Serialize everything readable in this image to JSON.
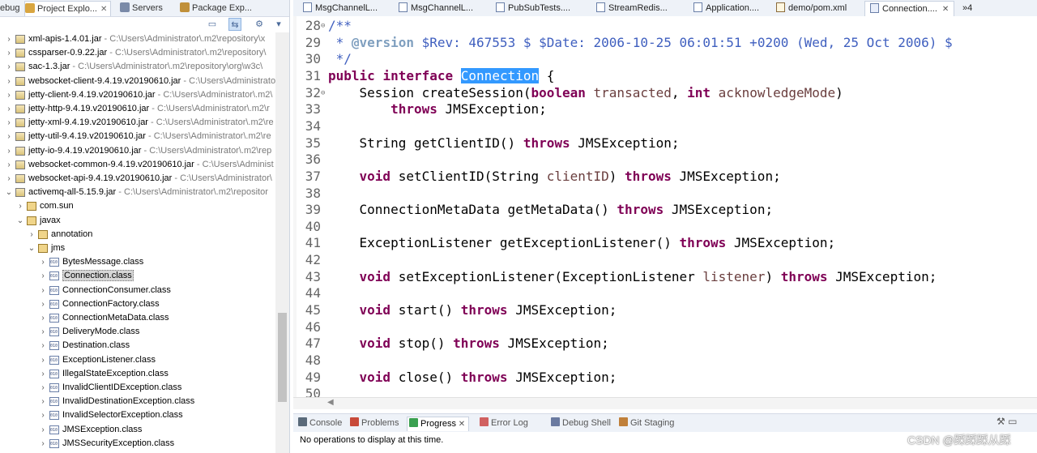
{
  "left_panel": {
    "tabs": [
      {
        "label": "ebug",
        "icon": "debug-icon",
        "active": false,
        "closable": false
      },
      {
        "label": "Project Explo...",
        "icon": "project-explorer-icon",
        "active": true,
        "closable": true
      },
      {
        "label": "Servers",
        "icon": "servers-icon",
        "active": false,
        "closable": false
      },
      {
        "label": "Package Exp...",
        "icon": "package-explorer-icon",
        "active": false,
        "closable": false
      }
    ],
    "tree": [
      {
        "type": "jar",
        "name": "xml-apis-1.4.01.jar",
        "path": " - C:\\Users\\Administrator\\.m2\\repository\\x",
        "indent": 0,
        "arrow": "collapsed"
      },
      {
        "type": "jar",
        "name": "cssparser-0.9.22.jar",
        "path": " - C:\\Users\\Administrator\\.m2\\repository\\",
        "indent": 0,
        "arrow": "collapsed"
      },
      {
        "type": "jar",
        "name": "sac-1.3.jar",
        "path": " - C:\\Users\\Administrator\\.m2\\repository\\org\\w3c\\",
        "indent": 0,
        "arrow": "collapsed"
      },
      {
        "type": "jar",
        "name": "websocket-client-9.4.19.v20190610.jar",
        "path": " - C:\\Users\\Administrato",
        "indent": 0,
        "arrow": "collapsed"
      },
      {
        "type": "jar",
        "name": "jetty-client-9.4.19.v20190610.jar",
        "path": " - C:\\Users\\Administrator\\.m2\\",
        "indent": 0,
        "arrow": "collapsed"
      },
      {
        "type": "jar",
        "name": "jetty-http-9.4.19.v20190610.jar",
        "path": " - C:\\Users\\Administrator\\.m2\\r",
        "indent": 0,
        "arrow": "collapsed"
      },
      {
        "type": "jar",
        "name": "jetty-xml-9.4.19.v20190610.jar",
        "path": " - C:\\Users\\Administrator\\.m2\\re",
        "indent": 0,
        "arrow": "collapsed"
      },
      {
        "type": "jar",
        "name": "jetty-util-9.4.19.v20190610.jar",
        "path": " - C:\\Users\\Administrator\\.m2\\re",
        "indent": 0,
        "arrow": "collapsed"
      },
      {
        "type": "jar",
        "name": "jetty-io-9.4.19.v20190610.jar",
        "path": " - C:\\Users\\Administrator\\.m2\\rep",
        "indent": 0,
        "arrow": "collapsed"
      },
      {
        "type": "jar",
        "name": "websocket-common-9.4.19.v20190610.jar",
        "path": " - C:\\Users\\Administ",
        "indent": 0,
        "arrow": "collapsed"
      },
      {
        "type": "jar",
        "name": "websocket-api-9.4.19.v20190610.jar",
        "path": " - C:\\Users\\Administrator\\",
        "indent": 0,
        "arrow": "collapsed"
      },
      {
        "type": "jar",
        "name": "activemq-all-5.15.9.jar",
        "path": " - C:\\Users\\Administrator\\.m2\\repositor",
        "indent": 0,
        "arrow": "expanded"
      },
      {
        "type": "pkg",
        "name": "com.sun",
        "path": "",
        "indent": 1,
        "arrow": "collapsed"
      },
      {
        "type": "pkg",
        "name": "javax",
        "path": "",
        "indent": 1,
        "arrow": "expanded"
      },
      {
        "type": "pkg",
        "name": "annotation",
        "path": "",
        "indent": 2,
        "arrow": "collapsed"
      },
      {
        "type": "pkg",
        "name": "jms",
        "path": "",
        "indent": 2,
        "arrow": "expanded"
      },
      {
        "type": "cls",
        "name": "BytesMessage.class",
        "path": "",
        "indent": 3,
        "arrow": "collapsed"
      },
      {
        "type": "cls",
        "name": "Connection.class",
        "path": "",
        "indent": 3,
        "arrow": "collapsed",
        "selected": true
      },
      {
        "type": "cls",
        "name": "ConnectionConsumer.class",
        "path": "",
        "indent": 3,
        "arrow": "collapsed"
      },
      {
        "type": "cls",
        "name": "ConnectionFactory.class",
        "path": "",
        "indent": 3,
        "arrow": "collapsed"
      },
      {
        "type": "cls",
        "name": "ConnectionMetaData.class",
        "path": "",
        "indent": 3,
        "arrow": "collapsed"
      },
      {
        "type": "cls",
        "name": "DeliveryMode.class",
        "path": "",
        "indent": 3,
        "arrow": "collapsed"
      },
      {
        "type": "cls",
        "name": "Destination.class",
        "path": "",
        "indent": 3,
        "arrow": "collapsed"
      },
      {
        "type": "cls",
        "name": "ExceptionListener.class",
        "path": "",
        "indent": 3,
        "arrow": "collapsed"
      },
      {
        "type": "cls",
        "name": "IllegalStateException.class",
        "path": "",
        "indent": 3,
        "arrow": "collapsed"
      },
      {
        "type": "cls",
        "name": "InvalidClientIDException.class",
        "path": "",
        "indent": 3,
        "arrow": "collapsed"
      },
      {
        "type": "cls",
        "name": "InvalidDestinationException.class",
        "path": "",
        "indent": 3,
        "arrow": "collapsed"
      },
      {
        "type": "cls",
        "name": "InvalidSelectorException.class",
        "path": "",
        "indent": 3,
        "arrow": "collapsed"
      },
      {
        "type": "cls",
        "name": "JMSException.class",
        "path": "",
        "indent": 3,
        "arrow": "collapsed"
      },
      {
        "type": "cls",
        "name": "JMSSecurityException.class",
        "path": "",
        "indent": 3,
        "arrow": "collapsed"
      }
    ]
  },
  "editor": {
    "tabs": [
      {
        "label": "MsgChannelL...",
        "icon": "java-file-icon",
        "active": false
      },
      {
        "label": "MsgChannelL...",
        "icon": "java-file-icon",
        "active": false
      },
      {
        "label": "PubSubTests....",
        "icon": "java-file-icon",
        "active": false
      },
      {
        "label": "StreamRedis...",
        "icon": "java-file-icon",
        "active": false
      },
      {
        "label": "Application....",
        "icon": "java-file-icon",
        "active": false
      },
      {
        "label": "demo/pom.xml",
        "icon": "xml-file-icon",
        "active": false
      },
      {
        "label": "Connection....",
        "icon": "class-file-icon",
        "active": true
      }
    ],
    "overflow_label": "»4",
    "lines": [
      {
        "n": "28",
        "fold": "⊖",
        "segs": [
          {
            "t": "/**",
            "c": "cm"
          }
        ]
      },
      {
        "n": "29",
        "fold": "",
        "segs": [
          {
            "t": " * ",
            "c": "cm"
          },
          {
            "t": "@version",
            "c": "cm-tag"
          },
          {
            "t": " $Rev: 467553 $ $Date: 2006-10-25 06:01:51 +0200 (Wed, 25 Oct 2006) $",
            "c": "cm"
          }
        ]
      },
      {
        "n": "30",
        "fold": "",
        "segs": [
          {
            "t": " */",
            "c": "cm"
          }
        ]
      },
      {
        "n": "31",
        "fold": "",
        "segs": [
          {
            "t": "public",
            "c": "kw"
          },
          {
            "t": " ",
            "c": ""
          },
          {
            "t": "interface",
            "c": "kw"
          },
          {
            "t": " ",
            "c": ""
          },
          {
            "t": "Connection",
            "c": "hl"
          },
          {
            "t": " {",
            "c": ""
          }
        ]
      },
      {
        "n": "32",
        "fold": "⊖",
        "segs": [
          {
            "t": "    Session createSession(",
            "c": ""
          },
          {
            "t": "boolean",
            "c": "kw"
          },
          {
            "t": " ",
            "c": ""
          },
          {
            "t": "transacted",
            "c": "param"
          },
          {
            "t": ", ",
            "c": ""
          },
          {
            "t": "int",
            "c": "kw"
          },
          {
            "t": " ",
            "c": ""
          },
          {
            "t": "acknowledgeMode",
            "c": "param"
          },
          {
            "t": ")",
            "c": ""
          }
        ]
      },
      {
        "n": "33",
        "fold": "",
        "segs": [
          {
            "t": "        ",
            "c": ""
          },
          {
            "t": "throws",
            "c": "kw"
          },
          {
            "t": " JMSException;",
            "c": ""
          }
        ]
      },
      {
        "n": "34",
        "fold": "",
        "segs": []
      },
      {
        "n": "35",
        "fold": "",
        "segs": [
          {
            "t": "    String getClientID() ",
            "c": ""
          },
          {
            "t": "throws",
            "c": "kw"
          },
          {
            "t": " JMSException;",
            "c": ""
          }
        ]
      },
      {
        "n": "36",
        "fold": "",
        "segs": []
      },
      {
        "n": "37",
        "fold": "",
        "segs": [
          {
            "t": "    ",
            "c": ""
          },
          {
            "t": "void",
            "c": "kw"
          },
          {
            "t": " setClientID(String ",
            "c": ""
          },
          {
            "t": "clientID",
            "c": "param"
          },
          {
            "t": ") ",
            "c": ""
          },
          {
            "t": "throws",
            "c": "kw"
          },
          {
            "t": " JMSException;",
            "c": ""
          }
        ]
      },
      {
        "n": "38",
        "fold": "",
        "segs": []
      },
      {
        "n": "39",
        "fold": "",
        "segs": [
          {
            "t": "    ConnectionMetaData getMetaData() ",
            "c": ""
          },
          {
            "t": "throws",
            "c": "kw"
          },
          {
            "t": " JMSException;",
            "c": ""
          }
        ]
      },
      {
        "n": "40",
        "fold": "",
        "segs": []
      },
      {
        "n": "41",
        "fold": "",
        "segs": [
          {
            "t": "    ExceptionListener getExceptionListener() ",
            "c": ""
          },
          {
            "t": "throws",
            "c": "kw"
          },
          {
            "t": " JMSException;",
            "c": ""
          }
        ]
      },
      {
        "n": "42",
        "fold": "",
        "segs": []
      },
      {
        "n": "43",
        "fold": "",
        "segs": [
          {
            "t": "    ",
            "c": ""
          },
          {
            "t": "void",
            "c": "kw"
          },
          {
            "t": " setExceptionListener(ExceptionListener ",
            "c": ""
          },
          {
            "t": "listener",
            "c": "param"
          },
          {
            "t": ") ",
            "c": ""
          },
          {
            "t": "throws",
            "c": "kw"
          },
          {
            "t": " JMSException;",
            "c": ""
          }
        ]
      },
      {
        "n": "44",
        "fold": "",
        "segs": []
      },
      {
        "n": "45",
        "fold": "",
        "segs": [
          {
            "t": "    ",
            "c": ""
          },
          {
            "t": "void",
            "c": "kw"
          },
          {
            "t": " start() ",
            "c": ""
          },
          {
            "t": "throws",
            "c": "kw"
          },
          {
            "t": " JMSException;",
            "c": ""
          }
        ]
      },
      {
        "n": "46",
        "fold": "",
        "segs": []
      },
      {
        "n": "47",
        "fold": "",
        "segs": [
          {
            "t": "    ",
            "c": ""
          },
          {
            "t": "void",
            "c": "kw"
          },
          {
            "t": " stop() ",
            "c": ""
          },
          {
            "t": "throws",
            "c": "kw"
          },
          {
            "t": " JMSException;",
            "c": ""
          }
        ]
      },
      {
        "n": "48",
        "fold": "",
        "segs": []
      },
      {
        "n": "49",
        "fold": "",
        "segs": [
          {
            "t": "    ",
            "c": ""
          },
          {
            "t": "void",
            "c": "kw"
          },
          {
            "t": " close() ",
            "c": ""
          },
          {
            "t": "throws",
            "c": "kw"
          },
          {
            "t": " JMSException;",
            "c": ""
          }
        ]
      },
      {
        "n": "50",
        "fold": "",
        "segs": []
      }
    ]
  },
  "bottom": {
    "tabs": [
      {
        "label": "Console",
        "icon": "console-icon",
        "active": false,
        "closable": false
      },
      {
        "label": "Problems",
        "icon": "problems-icon",
        "active": false,
        "closable": false
      },
      {
        "label": "Progress",
        "icon": "progress-icon",
        "active": true,
        "closable": true
      },
      {
        "label": "Error Log",
        "icon": "error-log-icon",
        "active": false,
        "closable": false
      },
      {
        "label": "Debug Shell",
        "icon": "debug-shell-icon",
        "active": false,
        "closable": false
      },
      {
        "label": "Git Staging",
        "icon": "git-staging-icon",
        "active": false,
        "closable": false
      }
    ],
    "status_text": "No operations to display at this time."
  },
  "watermark": "CSDN @踩踩踩从踩",
  "colors": {
    "keyword": "#7f0055",
    "comment": "#3f5fbf",
    "selection": "#3399ff"
  }
}
